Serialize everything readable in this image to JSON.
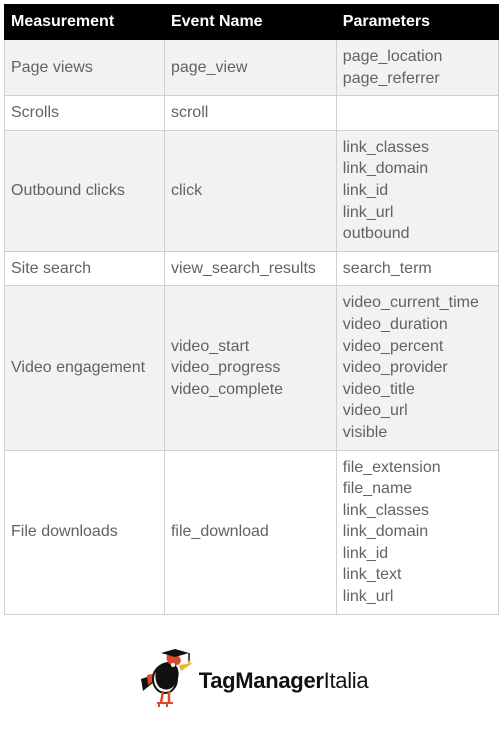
{
  "headers": {
    "col1": "Measurement",
    "col2": "Event Name",
    "col3": "Parameters"
  },
  "rows": [
    {
      "measurement": "Page views",
      "event_name": "page_view",
      "parameters": "page_location\npage_referrer"
    },
    {
      "measurement": "Scrolls",
      "event_name": "scroll",
      "parameters": ""
    },
    {
      "measurement": "Outbound clicks",
      "event_name": "click",
      "parameters": "link_classes\nlink_domain\nlink_id\nlink_url\noutbound"
    },
    {
      "measurement": "Site search",
      "event_name": "view_search_results",
      "parameters": "search_term"
    },
    {
      "measurement": "Video engagement",
      "event_name": "video_start\nvideo_progress\nvideo_complete",
      "parameters": "video_current_time\nvideo_duration\nvideo_percent\nvideo_provider\nvideo_title\nvideo_url\nvisible"
    },
    {
      "measurement": "File downloads",
      "event_name": "file_download",
      "parameters": "file_extension\nfile_name\nlink_classes\nlink_domain\nlink_id\nlink_text\nlink_url"
    }
  ],
  "logo": {
    "brand_part1": "TagManager",
    "brand_part2": "Italia"
  }
}
